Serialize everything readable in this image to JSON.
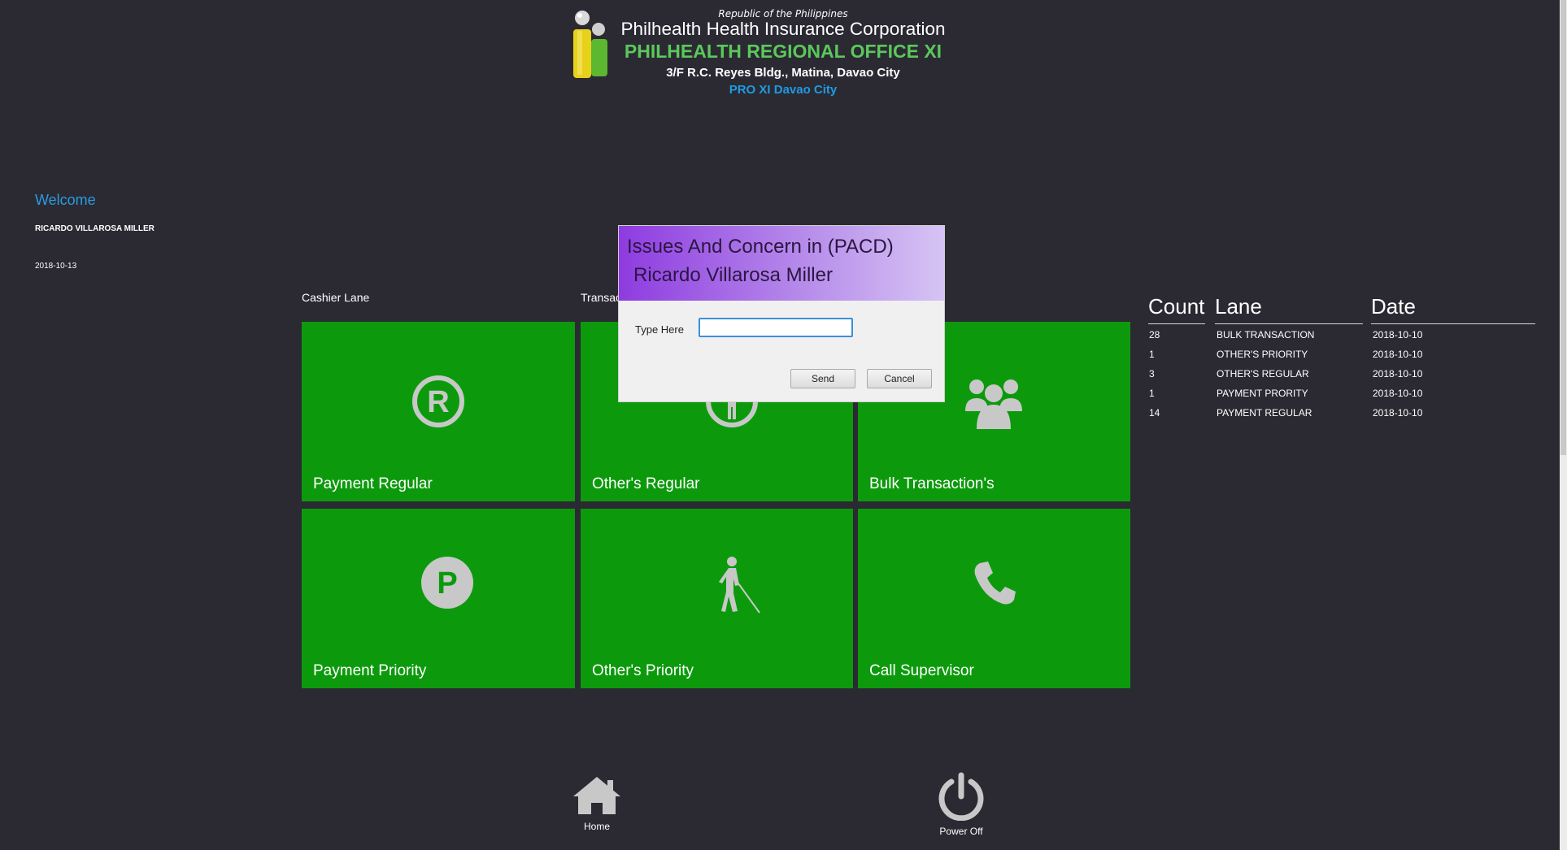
{
  "header": {
    "republic": "Republic of the Philippines",
    "corporation": "Philhealth Health Insurance Corporation",
    "office": "PHILHEALTH REGIONAL OFFICE XI",
    "address": "3/F R.C. Reyes Bldg., Matina, Davao City",
    "pro": "PRO XI Davao City"
  },
  "user": {
    "welcome": "Welcome",
    "name": "RICARDO VILLAROSA MILLER",
    "date": "2018-10-13"
  },
  "lanes": {
    "cashier": "Cashier Lane",
    "transaction": "Transac"
  },
  "tiles": [
    {
      "label": "Payment Regular",
      "icon": "registered-icon"
    },
    {
      "label": "Other's Regular",
      "icon": "person-circle-icon"
    },
    {
      "label": "Bulk Transaction's",
      "icon": "group-icon"
    },
    {
      "label": "Payment Priority",
      "icon": "p-circle-icon"
    },
    {
      "label": "Other's Priority",
      "icon": "blind-person-icon"
    },
    {
      "label": "Call Supervisor",
      "icon": "phone-icon"
    }
  ],
  "table": {
    "headers": [
      "Count",
      "Lane",
      "Date"
    ],
    "rows": [
      {
        "count": "28",
        "lane": "BULK TRANSACTION",
        "date": "2018-10-10"
      },
      {
        "count": "1",
        "lane": "OTHER'S PRIORITY",
        "date": "2018-10-10"
      },
      {
        "count": "3",
        "lane": "OTHER'S REGULAR",
        "date": "2018-10-10"
      },
      {
        "count": "1",
        "lane": "PAYMENT PRORITY",
        "date": "2018-10-10"
      },
      {
        "count": "14",
        "lane": "PAYMENT REGULAR",
        "date": "2018-10-10"
      }
    ]
  },
  "bottom": {
    "home": "Home",
    "power": "Power Off"
  },
  "dialog": {
    "title": "Issues And Concern in (PACD)",
    "name": "Ricardo Villarosa Miller",
    "field_label": "Type Here",
    "field_value": "",
    "send": "Send",
    "cancel": "Cancel"
  },
  "colors": {
    "background": "#2b2a33",
    "tile": "#0c9a0c",
    "accent_green": "#5bc85b",
    "accent_blue": "#1e9be3",
    "dialog_header": "#8e3be0"
  }
}
